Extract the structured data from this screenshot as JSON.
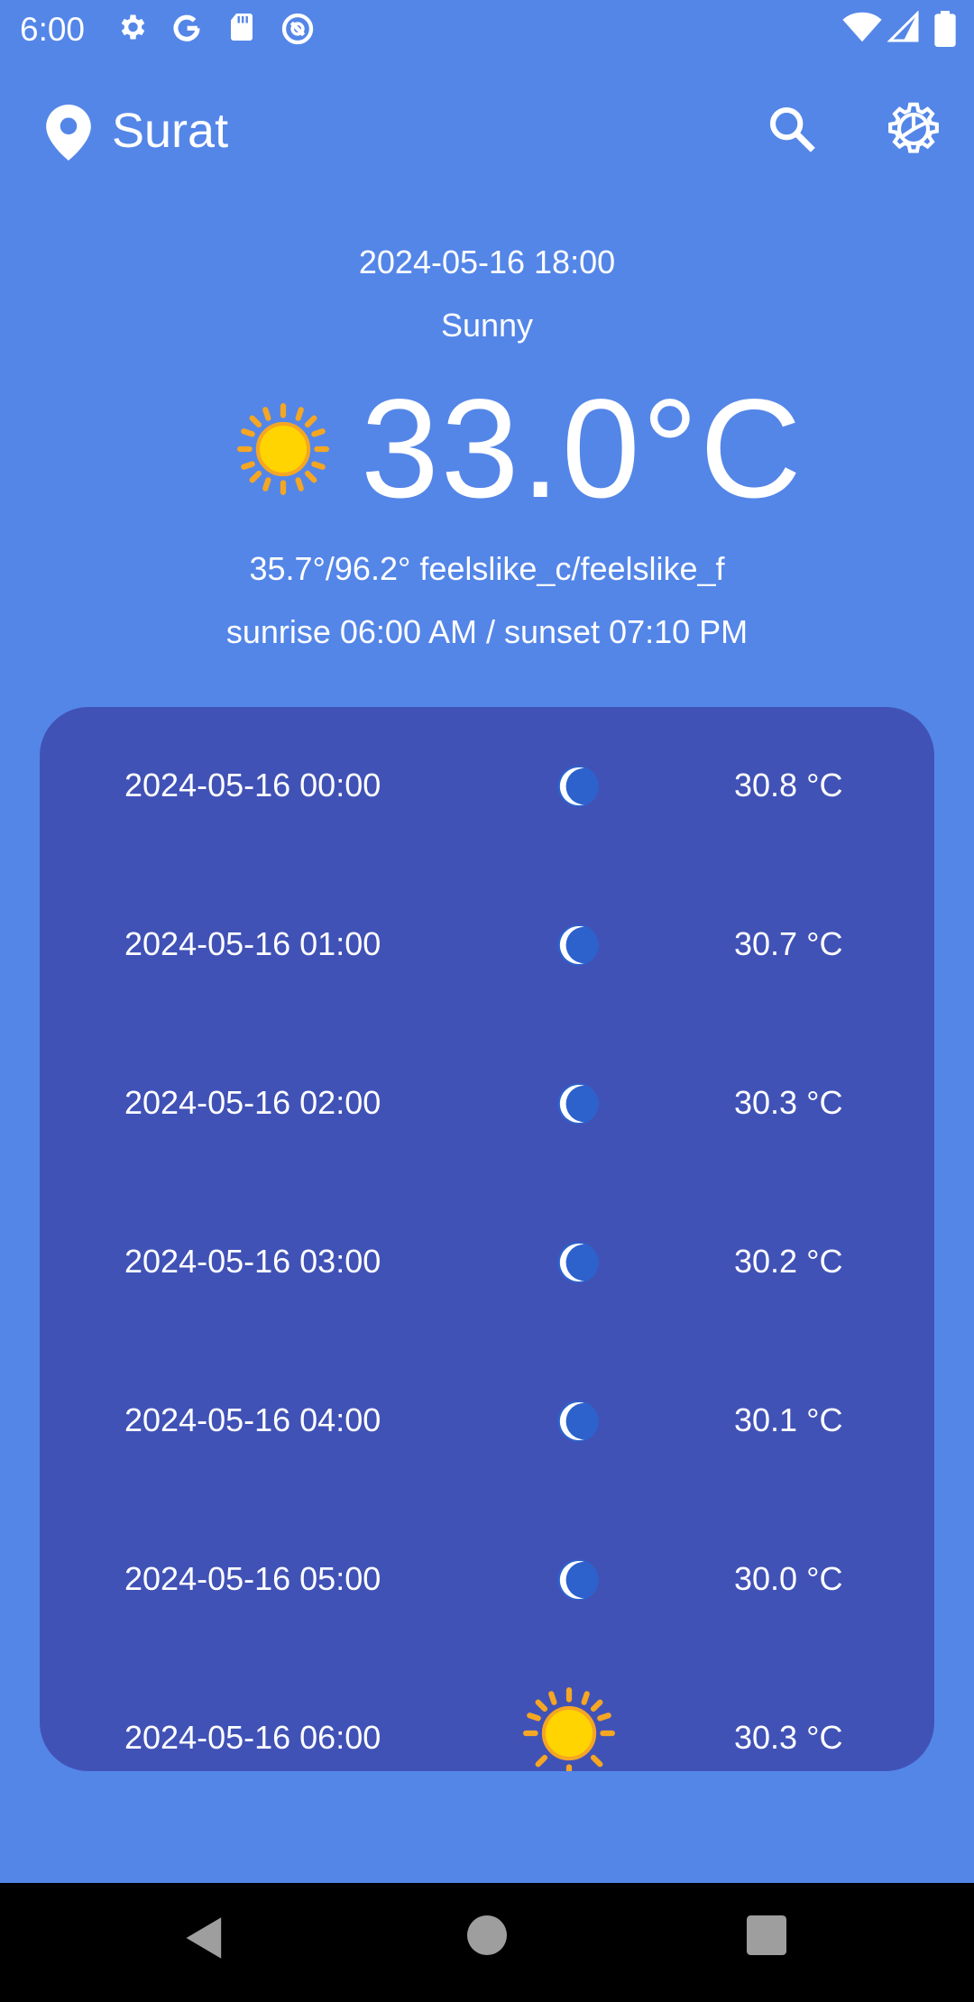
{
  "status_bar": {
    "time": "6:00",
    "icons": [
      "gear-icon",
      "google-icon",
      "sd-card-icon",
      "vpn-icon",
      "wifi-icon",
      "signal-icon",
      "battery-icon"
    ]
  },
  "header": {
    "city": "Surat",
    "location_icon": "location-pin-icon",
    "search_icon": "search-icon",
    "settings_icon": "settings-gear-icon"
  },
  "current": {
    "datetime": "2024-05-16 18:00",
    "condition": "Sunny",
    "icon": "sun-icon",
    "temperature": "33.0°C",
    "feels_like": "35.7°/96.2° feelslike_c/feelslike_f",
    "sun_times": "sunrise 06:00 AM / sunset 07:10 PM"
  },
  "hourly": [
    {
      "time": "2024-05-16 00:00",
      "icon": "moon-icon",
      "temp": "30.8 °C"
    },
    {
      "time": "2024-05-16 01:00",
      "icon": "moon-icon",
      "temp": "30.7 °C"
    },
    {
      "time": "2024-05-16 02:00",
      "icon": "moon-icon",
      "temp": "30.3 °C"
    },
    {
      "time": "2024-05-16 03:00",
      "icon": "moon-icon",
      "temp": "30.2 °C"
    },
    {
      "time": "2024-05-16 04:00",
      "icon": "moon-icon",
      "temp": "30.1 °C"
    },
    {
      "time": "2024-05-16 05:00",
      "icon": "moon-icon",
      "temp": "30.0 °C"
    },
    {
      "time": "2024-05-16 06:00",
      "icon": "sun-icon",
      "temp": "30.3 °C"
    }
  ],
  "colors": {
    "background": "#5486E8",
    "card": "#4152B6",
    "sun": "#FFD400",
    "sun_rays": "#F5A623",
    "moon": "#FFFFFF",
    "moon_glow": "#1E6FE0"
  },
  "navigation": {
    "icons": [
      "back-icon",
      "home-icon",
      "recents-icon"
    ]
  }
}
